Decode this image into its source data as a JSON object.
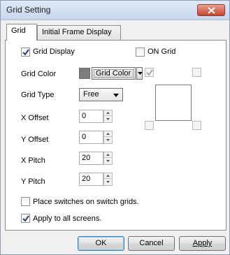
{
  "window": {
    "title": "Grid Setting"
  },
  "tabs": [
    {
      "label": "Grid",
      "active": true
    },
    {
      "label": "Initial Frame Display",
      "active": false
    }
  ],
  "grid_display": {
    "label": "Grid Display",
    "checked": true
  },
  "on_grid": {
    "label": "ON Grid",
    "checked": false
  },
  "grid_color": {
    "label": "Grid Color",
    "button_label": "Grid Color",
    "swatch_color": "#7d7d7d"
  },
  "grid_type": {
    "label": "Grid Type",
    "value": "Free"
  },
  "x_offset": {
    "label": "X Offset",
    "value": "0"
  },
  "y_offset": {
    "label": "Y Offset",
    "value": "0"
  },
  "x_pitch": {
    "label": "X Pitch",
    "value": "20"
  },
  "y_pitch": {
    "label": "Y Pitch",
    "value": "20"
  },
  "place_switches": {
    "label": "Place switches on switch grids.",
    "checked": false
  },
  "apply_all": {
    "label": "Apply to all screens.",
    "checked": true
  },
  "buttons": {
    "ok": "OK",
    "cancel": "Cancel",
    "apply": "Apply"
  }
}
